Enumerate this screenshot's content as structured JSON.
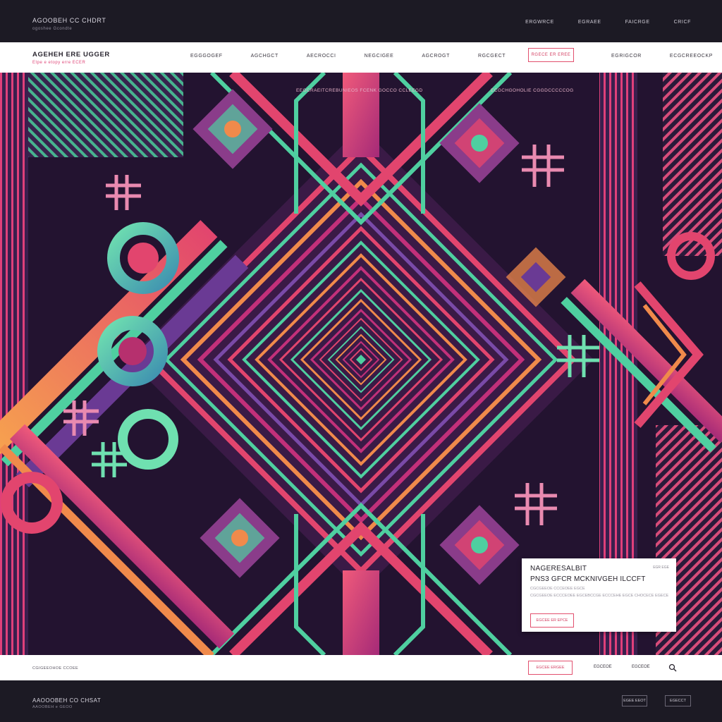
{
  "topbar": {
    "brand": "AGOOBEH CC CHDRT",
    "brand_sub": "ogoshee   Gcondte",
    "nav": [
      "ERGWRCE",
      "EGRAEE",
      "FAICRGE",
      "CRICF"
    ]
  },
  "header": {
    "brand": "AGEHEH ERE UGGER",
    "brand_sub": "Etpe e etopy erre ECER",
    "nav": [
      "EGGGOGEF",
      "AGCHGCT",
      "AECROCCI",
      "NEGCIGEE",
      "AGCROGT",
      "RGCGECT"
    ],
    "cta": "RGECE   ER EREE",
    "right": [
      "EGRIGCOR",
      "ECGCREEOCKP"
    ]
  },
  "art": {
    "caption_left": "EEGCRAEITCREBUNIEOS  FCENK GOCCO CCLEEGD",
    "caption_right": "ECGCHGOHOLIE   CGGDCCCCCOG"
  },
  "card": {
    "title": "NAGERESALBIT",
    "subtitle": "PNS3 GFCR MCKNIVGEH ILCCFT",
    "meta": "EGR EGE",
    "line1": "CGCGEEOE CCCEOEE EGCE",
    "line2": "CGCGEEOE ECCCEOEE EGCEBCCGE ECCCEHE EGCE CHOCECE EGECE",
    "button": "EGCEE    ER EPCE"
  },
  "bottombar": {
    "label": "CGIGEEOHOE CCOEE",
    "button": "EGCEE    ERGEE",
    "link1": "EGCEOE",
    "link2": "EGCEOE"
  },
  "footer": {
    "brand": "AAOOOBEH CO CHSAT",
    "brand_sub": "AAOOBEH  e  GEOO",
    "btn1": "EGEE EEOT",
    "btn2": "EGECCT"
  },
  "colors": {
    "pink": "#e23c6e",
    "magenta": "#c2307a",
    "purple": "#5a2f7c",
    "teal": "#4ed3a4",
    "orange": "#f08a4b",
    "dark": "#1c1a24"
  }
}
